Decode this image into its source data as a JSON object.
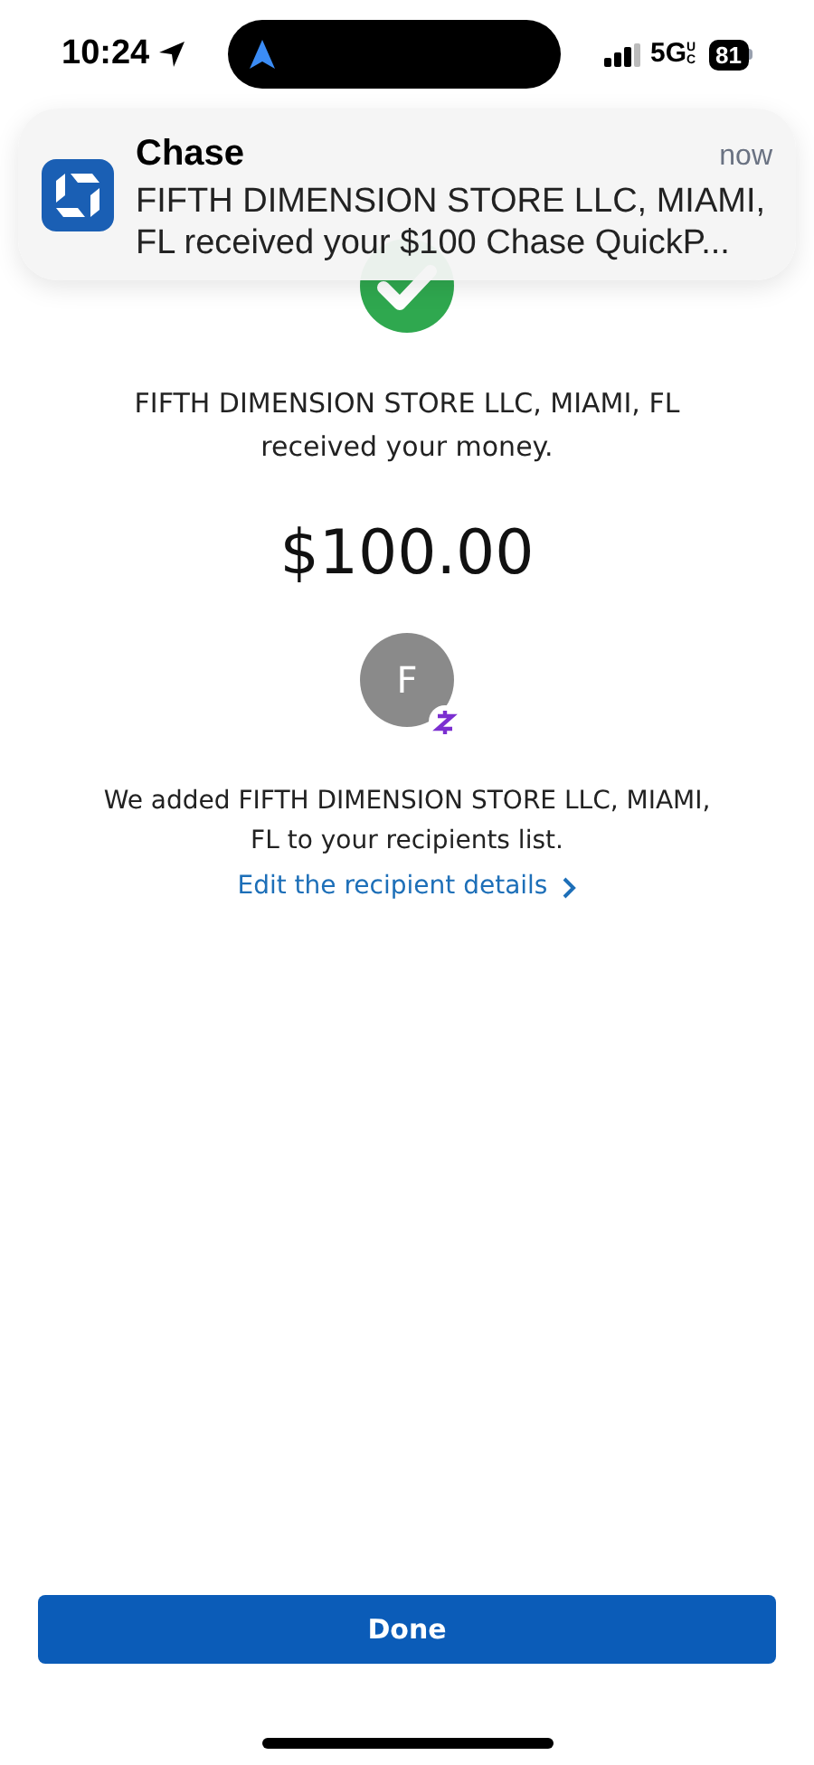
{
  "status_bar": {
    "time": "10:24",
    "network": "5G",
    "network_suffix": "UC",
    "battery": "81"
  },
  "notification": {
    "app": "Chase",
    "time": "now",
    "message": "FIFTH DIMENSION STORE LLC, MIAMI, FL received your $100 Chase QuickP..."
  },
  "confirmation": {
    "message_line_1": "FIFTH DIMENSION STORE LLC, MIAMI, FL",
    "message_line_2": "received your money.",
    "amount": "$100.00",
    "avatar_initial": "F",
    "recipient_note_line_1": "We added FIFTH DIMENSION STORE LLC, MIAMI,",
    "recipient_note_line_2": "FL to your recipients list.",
    "edit_link": "Edit the recipient details"
  },
  "buttons": [
    {
      "label": "Done"
    }
  ]
}
